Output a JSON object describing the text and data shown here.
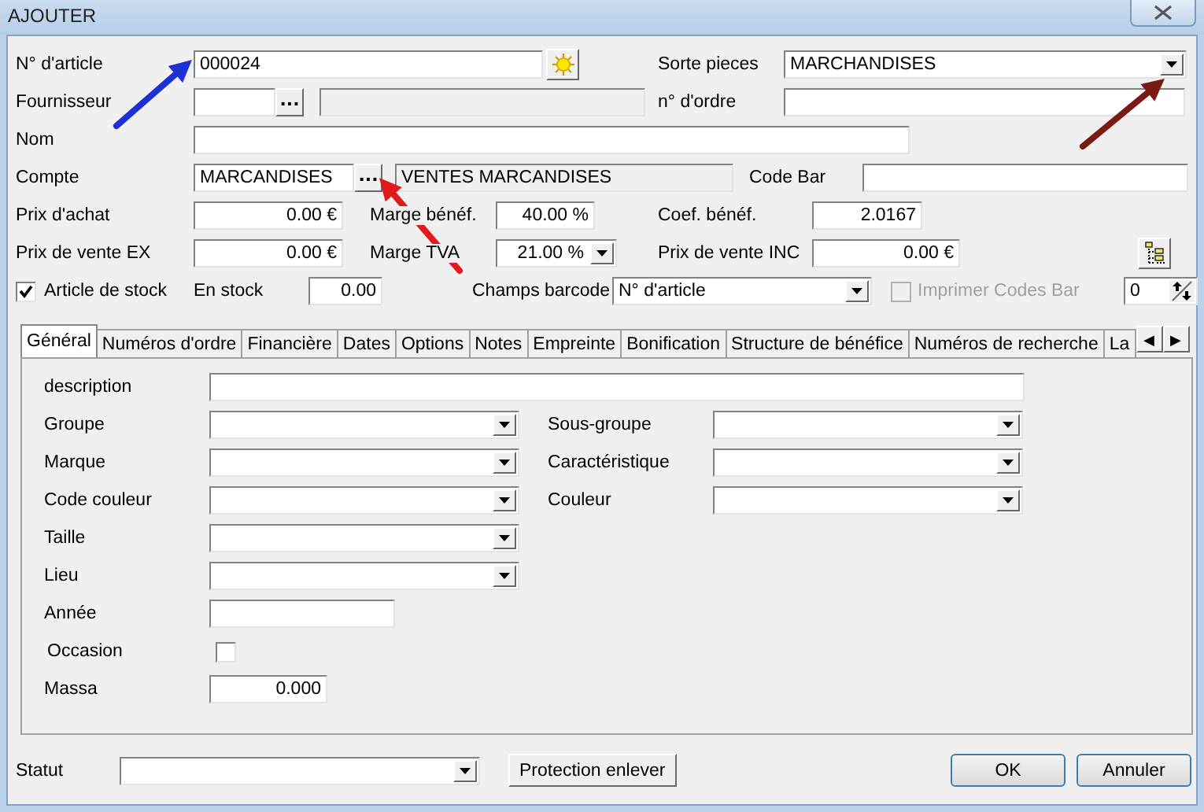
{
  "window": {
    "title": "AJOUTER"
  },
  "header": {
    "article": {
      "label": "N° d'article",
      "value": "000024"
    },
    "sorte_pieces": {
      "label": "Sorte pieces",
      "value": "MARCHANDISES"
    },
    "fournisseur": {
      "label": "Fournisseur",
      "button": "..."
    },
    "numero_ordre": {
      "label": "n° d'ordre"
    },
    "nom": {
      "label": "Nom"
    },
    "compte": {
      "label": "Compte",
      "value": "MARCANDISES",
      "button": "...",
      "description": "VENTES MARCANDISES"
    },
    "code_bar": {
      "label": "Code Bar"
    },
    "prix_achat": {
      "label": "Prix d'achat",
      "value": "0.00 €"
    },
    "marge_benef": {
      "label": "Marge bénéf.",
      "value": "40.00 %"
    },
    "coef_benef": {
      "label": "Coef. bénéf.",
      "value": "2.0167"
    },
    "prix_vente_ex": {
      "label": "Prix de vente EX",
      "value": "0.00 €"
    },
    "marge_tva": {
      "label": "Marge TVA",
      "value": "21.00 %"
    },
    "prix_vente_inc": {
      "label": "Prix de vente INC",
      "value": "0.00 €"
    },
    "article_stock": {
      "label": "Article de stock",
      "checked": true
    },
    "en_stock": {
      "label": "En stock",
      "value": "0.00"
    },
    "champs_barcode": {
      "label": "Champs barcode",
      "value": "N° d'article"
    },
    "imprimer": {
      "label": "Imprimer Codes Bar",
      "checked": false,
      "disabled": true
    },
    "copies": {
      "value": "0"
    }
  },
  "tabs": [
    {
      "label": "Général",
      "selected": true
    },
    {
      "label": "Numéros d'ordre",
      "selected": false
    },
    {
      "label": "Financière",
      "selected": false
    },
    {
      "label": "Dates",
      "selected": false
    },
    {
      "label": "Options",
      "selected": false
    },
    {
      "label": "Notes",
      "selected": false
    },
    {
      "label": "Empreinte",
      "selected": false
    },
    {
      "label": "Bonification",
      "selected": false
    },
    {
      "label": "Structure de bénéfice",
      "selected": false
    },
    {
      "label": "Numéros de recherche",
      "selected": false
    },
    {
      "label": "La",
      "selected": false
    }
  ],
  "tab_scroll": [
    "◀",
    "▶"
  ],
  "general": {
    "description": {
      "label": "description"
    },
    "combos_left": [
      {
        "label": "Groupe"
      },
      {
        "label": "Marque"
      },
      {
        "label": "Code couleur"
      },
      {
        "label": "Taille"
      },
      {
        "label": "Lieu"
      }
    ],
    "combos_right": [
      {
        "label": "Sous-groupe"
      },
      {
        "label": "Caractéristique"
      },
      {
        "label": "Couleur"
      }
    ],
    "annee": {
      "label": "Année"
    },
    "occasion": {
      "label": "Occasion",
      "checked": false
    },
    "massa": {
      "label": "Massa",
      "value": "0.000"
    }
  },
  "footer": {
    "statut": {
      "label": "Statut"
    },
    "protection_button": "Protection enlever",
    "dialog_buttons": [
      "OK",
      "Annuler"
    ]
  },
  "annotations": [
    {
      "kind": "arrow",
      "color": "#1f2fd6"
    },
    {
      "kind": "arrow",
      "color": "#e31a1a"
    },
    {
      "kind": "arrow",
      "color": "#7a1a14"
    }
  ]
}
